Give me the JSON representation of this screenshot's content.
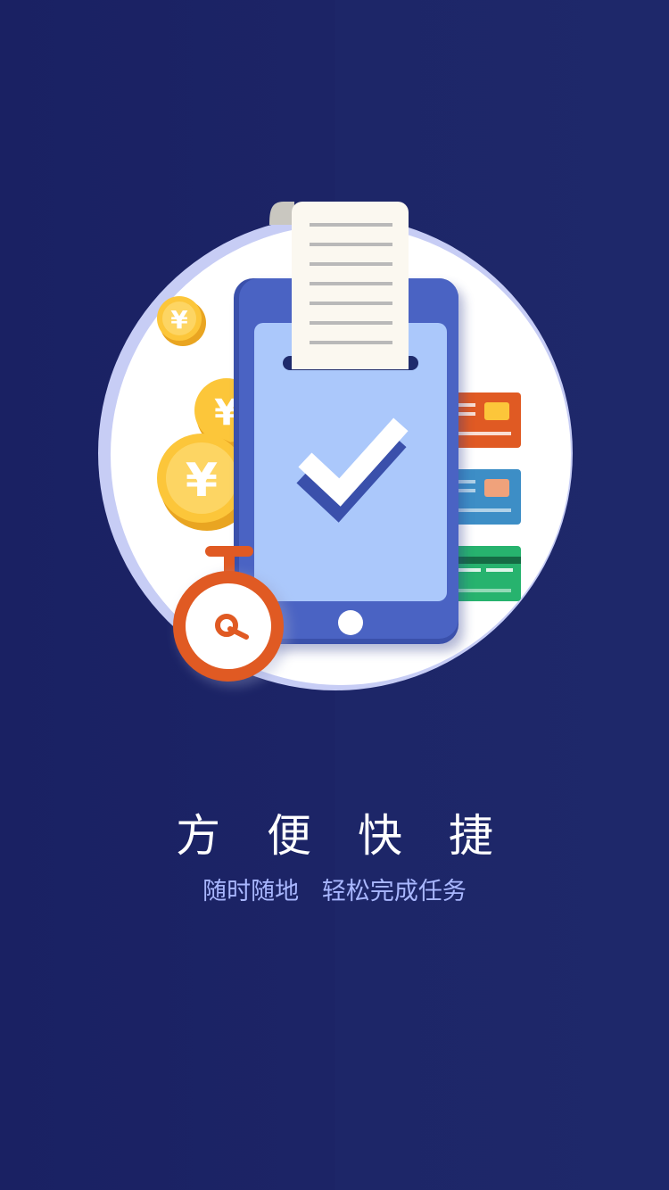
{
  "onboarding": {
    "title": "方 便 快 捷",
    "subtitle": "随时随地   轻松完成任务"
  },
  "icons": {
    "coin": "yuan-coin-icon",
    "stopwatch": "stopwatch-icon",
    "phone": "smartphone-icon",
    "receipt": "receipt-icon",
    "check": "checkmark-icon",
    "card": "bank-card-icon"
  },
  "colors": {
    "background": "#1b2264",
    "circle": "#ffffff",
    "phone_body": "#4a63c3",
    "phone_screen": "#abc8fb",
    "coin": "#fcc63a",
    "stopwatch": "#e05a23",
    "card_orange": "#e05a23",
    "card_blue": "#3d8ec6",
    "card_green": "#27b36e",
    "subtitle": "#a9b7ff"
  }
}
